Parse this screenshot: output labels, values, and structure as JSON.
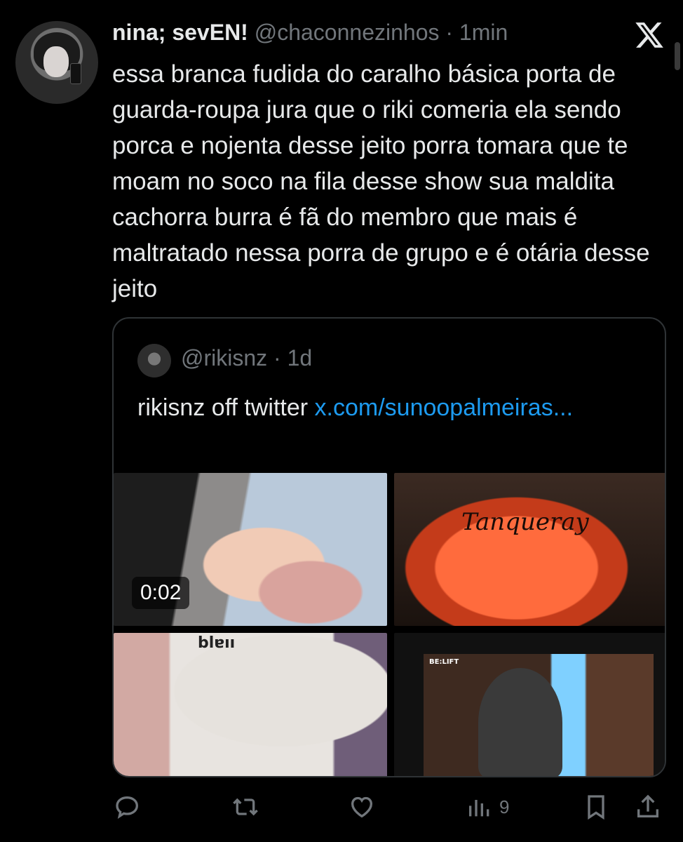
{
  "tweet": {
    "author": {
      "display_name": "nina; sevEN!",
      "handle": "@chaconnezinhos",
      "separator": "·",
      "time": "1min"
    },
    "text": "essa branca fudida do caralho básica porta de guarda-roupa jura que o riki comeria ela sendo porca e nojenta desse jeito porra tomara que te moam no soco na fila desse show sua maldita cachorra burra é fã do membro que mais é maltratado nessa porra de grupo e é otária desse jeito"
  },
  "quote": {
    "handle": "@rikisnz",
    "separator": "·",
    "time": "1d",
    "text": "rikisnz off twitter ",
    "link_text": "x.com/sunoopalmeiras...",
    "media": {
      "video_duration": "0:02",
      "image2_text": "Tanqueray",
      "image3_text": "blɐıı",
      "image4_text": "BE:LIFT"
    }
  },
  "actions": {
    "views_count": "9"
  },
  "colors": {
    "background": "#000000",
    "text": "#e7e9ea",
    "muted": "#71767b",
    "link": "#1d9bf0",
    "border": "#2f3336"
  },
  "icons": [
    "x-logo-icon",
    "reply-icon",
    "retweet-icon",
    "like-icon",
    "views-icon",
    "bookmark-icon",
    "share-icon"
  ]
}
